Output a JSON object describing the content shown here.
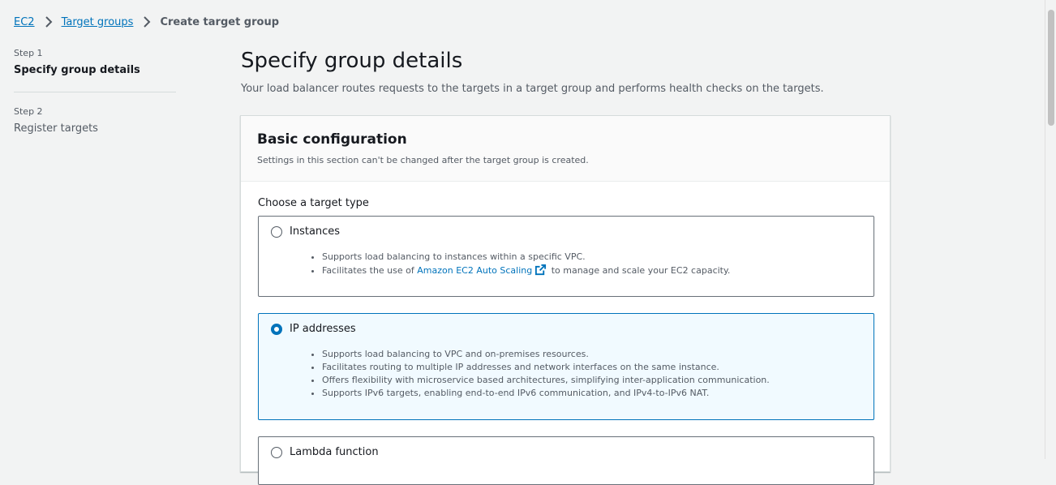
{
  "breadcrumb": {
    "items": [
      {
        "label": "EC2"
      },
      {
        "label": "Target groups"
      }
    ],
    "current": "Create target group"
  },
  "steps": [
    {
      "number": "Step 1",
      "title": "Specify group details",
      "active": true
    },
    {
      "number": "Step 2",
      "title": "Register targets",
      "active": false
    }
  ],
  "page": {
    "title": "Specify group details",
    "description": "Your load balancer routes requests to the targets in a target group and performs health checks on the targets."
  },
  "basic_config": {
    "title": "Basic configuration",
    "subtitle": "Settings in this section can't be changed after the target group is created.",
    "target_type_label": "Choose a target type",
    "options": [
      {
        "label": "Instances",
        "selected": false,
        "bullets": [
          "Supports load balancing to instances within a specific VPC."
        ],
        "bullet2_prefix": "Facilitates the use of ",
        "bullet2_link": "Amazon EC2 Auto Scaling",
        "bullet2_suffix": " to manage and scale your EC2 capacity."
      },
      {
        "label": "IP addresses",
        "selected": true,
        "bullets": [
          "Supports load balancing to VPC and on-premises resources.",
          "Facilitates routing to multiple IP addresses and network interfaces on the same instance.",
          "Offers flexibility with microservice based architectures, simplifying inter-application communication.",
          "Supports IPv6 targets, enabling end-to-end IPv6 communication, and IPv4-to-IPv6 NAT."
        ]
      },
      {
        "label": "Lambda function",
        "selected": false
      }
    ]
  },
  "icons": {
    "breadcrumb_separator": "chevron-right-icon",
    "external_link": "external-link-icon"
  },
  "colors": {
    "link": "#0073bb",
    "selected_border": "#0073bb",
    "selected_background": "#f1faff"
  }
}
